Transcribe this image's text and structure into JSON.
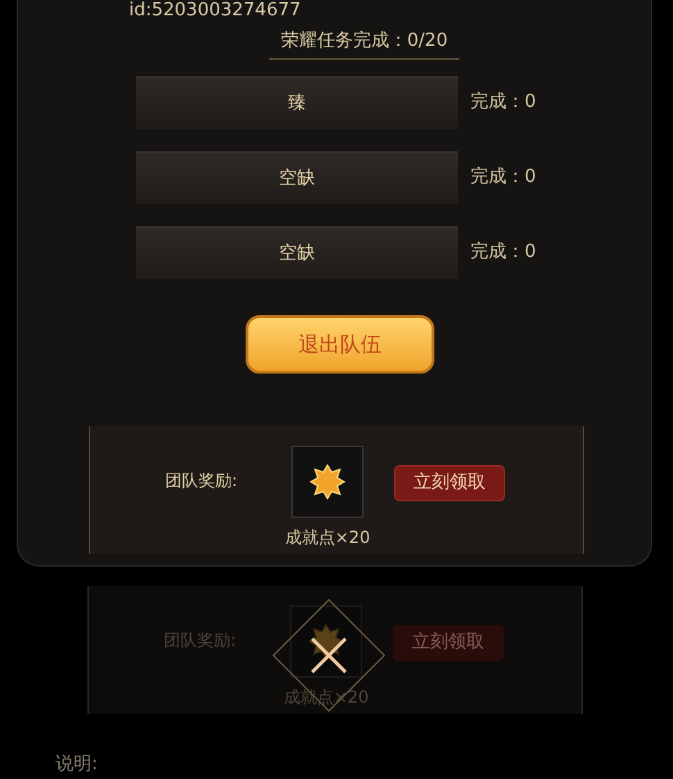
{
  "player_id": "id:5203003274677",
  "honor_progress": "荣耀任务完成：0/20",
  "members": [
    {
      "name": "臻",
      "progress": "完成：0"
    },
    {
      "name": "空缺",
      "progress": "完成：0"
    },
    {
      "name": "空缺",
      "progress": "完成：0"
    }
  ],
  "exit_button": "退出队伍",
  "reward": {
    "label": "团队奖励:",
    "item_caption": "成就点×20",
    "claim_button": "立刻领取"
  },
  "background_reward": {
    "label": "团队奖励:",
    "item_caption": "成就点×20",
    "claim_button": "立刻领取"
  },
  "note_label": "说明:"
}
